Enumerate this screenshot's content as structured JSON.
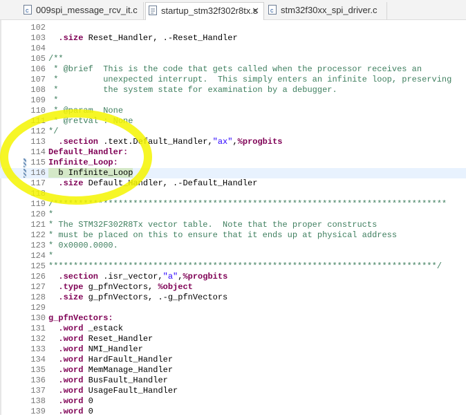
{
  "tabs": [
    {
      "label": "009spi_message_rcv_it.c",
      "icon": "c-file-icon",
      "active": false
    },
    {
      "label": "startup_stm32f302r8tx.s",
      "icon": "asm-file-icon",
      "active": true,
      "close": "✕"
    },
    {
      "label": "stm32f30xx_spi_driver.c",
      "icon": "c-file-icon",
      "active": false
    }
  ],
  "lines": [
    {
      "n": "102",
      "parts": []
    },
    {
      "n": "103",
      "parts": [
        [
          "k",
          "  .size"
        ],
        [
          "t",
          " Reset_Handler, .-Reset_Handler"
        ]
      ]
    },
    {
      "n": "104",
      "parts": []
    },
    {
      "n": "105",
      "parts": [
        [
          "c",
          "/**"
        ]
      ]
    },
    {
      "n": "106",
      "parts": [
        [
          "c",
          " * @brief  This is the code that gets called when the processor receives an"
        ]
      ]
    },
    {
      "n": "107",
      "parts": [
        [
          "c",
          " *         unexpected interrupt.  This simply enters an infinite loop, preserving"
        ]
      ]
    },
    {
      "n": "108",
      "parts": [
        [
          "c",
          " *         the system state for examination by a debugger."
        ]
      ]
    },
    {
      "n": "109",
      "parts": [
        [
          "c",
          " *"
        ]
      ]
    },
    {
      "n": "110",
      "parts": [
        [
          "c",
          " * @param  None"
        ]
      ]
    },
    {
      "n": "111",
      "parts": [
        [
          "c",
          " * @retval : None"
        ]
      ]
    },
    {
      "n": "112",
      "parts": [
        [
          "c",
          "*/"
        ]
      ]
    },
    {
      "n": "113",
      "parts": [
        [
          "k",
          "  .section"
        ],
        [
          "t",
          " .text.Default_Handler,"
        ],
        [
          "s",
          "\"ax\""
        ],
        [
          "t",
          ","
        ],
        [
          "k",
          "%progbits"
        ]
      ]
    },
    {
      "n": "114",
      "parts": [
        [
          "lab",
          "Default_Handler:"
        ]
      ]
    },
    {
      "n": "115",
      "parts": [
        [
          "lab",
          "Infinite_Loop:"
        ]
      ],
      "marker": true
    },
    {
      "n": "116",
      "parts": [
        [
          "hl",
          "  b Infinite_Loop"
        ]
      ],
      "current": true,
      "marker": true
    },
    {
      "n": "117",
      "parts": [
        [
          "k",
          "  .size"
        ],
        [
          "t",
          " Default_Handler, .-Default_Handler"
        ]
      ]
    },
    {
      "n": "118",
      "parts": []
    },
    {
      "n": "119",
      "parts": [
        [
          "c",
          "/*******************************************************************************"
        ]
      ]
    },
    {
      "n": "120",
      "parts": [
        [
          "c",
          "*"
        ]
      ]
    },
    {
      "n": "121",
      "parts": [
        [
          "c",
          "* The STM32F302R8Tx vector table.  Note that the proper constructs"
        ]
      ]
    },
    {
      "n": "122",
      "parts": [
        [
          "c",
          "* must be placed on this to ensure that it ends up at physical address"
        ]
      ]
    },
    {
      "n": "123",
      "parts": [
        [
          "c",
          "* 0x0000.0000."
        ]
      ]
    },
    {
      "n": "124",
      "parts": [
        [
          "c",
          "*"
        ]
      ]
    },
    {
      "n": "125",
      "parts": [
        [
          "c",
          "******************************************************************************/"
        ]
      ]
    },
    {
      "n": "126",
      "parts": [
        [
          "k",
          "  .section"
        ],
        [
          "t",
          " .isr_vector,"
        ],
        [
          "s",
          "\"a\""
        ],
        [
          "t",
          ","
        ],
        [
          "k",
          "%progbits"
        ]
      ]
    },
    {
      "n": "127",
      "parts": [
        [
          "k",
          "  .type"
        ],
        [
          "t",
          " g_pfnVectors, "
        ],
        [
          "k",
          "%object"
        ]
      ]
    },
    {
      "n": "128",
      "parts": [
        [
          "k",
          "  .size"
        ],
        [
          "t",
          " g_pfnVectors, .-g_pfnVectors"
        ]
      ]
    },
    {
      "n": "129",
      "parts": []
    },
    {
      "n": "130",
      "parts": [
        [
          "lab",
          "g_pfnVectors:"
        ]
      ]
    },
    {
      "n": "131",
      "parts": [
        [
          "k",
          "  .word"
        ],
        [
          "t",
          " _estack"
        ]
      ]
    },
    {
      "n": "132",
      "parts": [
        [
          "k",
          "  .word"
        ],
        [
          "t",
          " Reset_Handler"
        ]
      ]
    },
    {
      "n": "133",
      "parts": [
        [
          "k",
          "  .word"
        ],
        [
          "t",
          " NMI_Handler"
        ]
      ]
    },
    {
      "n": "134",
      "parts": [
        [
          "k",
          "  .word"
        ],
        [
          "t",
          " HardFault_Handler"
        ]
      ]
    },
    {
      "n": "135",
      "parts": [
        [
          "k",
          "  .word"
        ],
        [
          "t",
          " MemManage_Handler"
        ]
      ]
    },
    {
      "n": "136",
      "parts": [
        [
          "k",
          "  .word"
        ],
        [
          "t",
          " BusFault_Handler"
        ]
      ]
    },
    {
      "n": "137",
      "parts": [
        [
          "k",
          "  .word"
        ],
        [
          "t",
          " UsageFault_Handler"
        ]
      ]
    },
    {
      "n": "138",
      "parts": [
        [
          "k",
          "  .word"
        ],
        [
          "t",
          " 0"
        ]
      ]
    },
    {
      "n": "139",
      "parts": [
        [
          "k",
          "  .word"
        ],
        [
          "t",
          " 0"
        ]
      ]
    }
  ]
}
